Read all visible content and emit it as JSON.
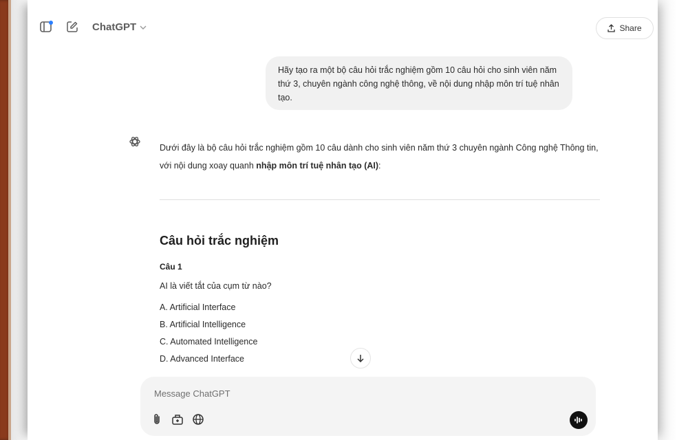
{
  "header": {
    "model_name": "ChatGPT",
    "share_label": "Share"
  },
  "user_message": {
    "text": "Hãy tạo ra một bộ câu hỏi trắc nghiệm gồm 10 câu hỏi cho sinh viên năm thứ 3, chuyên ngành công nghệ thông, về nội dung nhập môn trí tuệ nhân tạo."
  },
  "assistant": {
    "intro_prefix": "Dưới đây là bộ câu hỏi trắc nghiệm gồm 10 câu dành cho sinh viên năm thứ 3 chuyên ngành Công nghệ Thông tin, với nội dung xoay quanh ",
    "intro_bold": "nhập môn trí tuệ nhân tạo (AI)",
    "intro_suffix": ":",
    "section_title": "Câu hỏi trắc nghiệm",
    "question": {
      "label": "Câu 1",
      "text": "AI là viết tắt của cụm từ nào?",
      "options": [
        "A. Artificial Interface",
        "B. Artificial Intelligence",
        "C. Automated Intelligence",
        "D. Advanced Interface"
      ]
    }
  },
  "composer": {
    "placeholder": "Message ChatGPT"
  },
  "icons": {
    "sidebar": "sidebar-toggle-icon",
    "new_chat": "edit-icon",
    "share": "share-icon",
    "avatar": "openai-logo-icon",
    "scroll": "arrow-down-icon",
    "attach": "paperclip-icon",
    "tools": "tools-icon",
    "search": "globe-icon",
    "voice": "voice-mode-icon"
  },
  "colors": {
    "accent_dot": "#2b7fff",
    "user_bubble": "#f1f1f1",
    "composer_bg": "#f4f4f4",
    "frame": "#8a3a1c"
  }
}
